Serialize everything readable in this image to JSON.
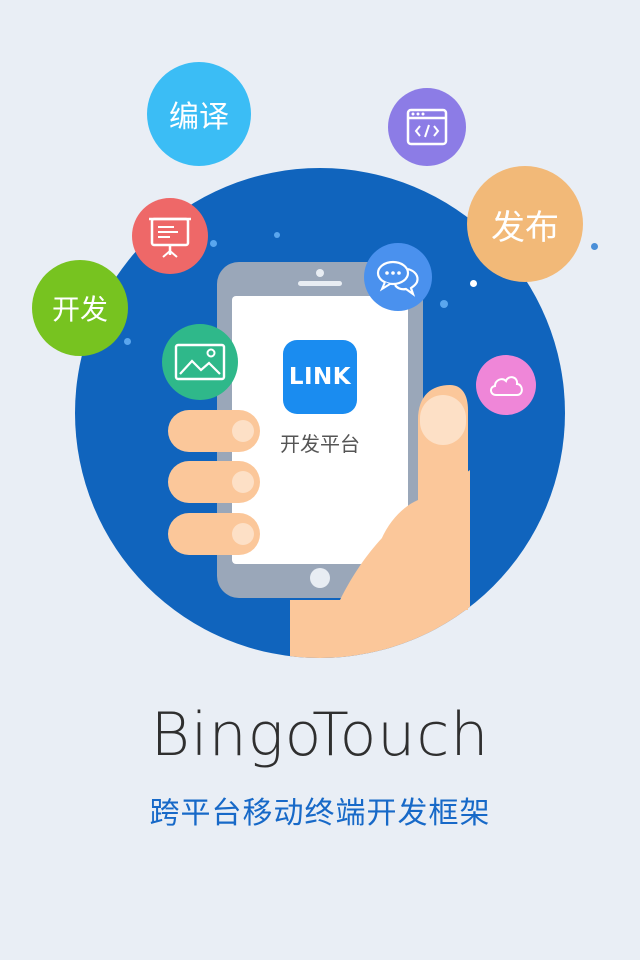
{
  "splash": {
    "app_name": "BingoTouch",
    "tagline": "跨平台移动终端开发框架",
    "phone": {
      "logo_text": "LINK",
      "logo_caption": "开发平台"
    },
    "bubbles": {
      "compile": "编译",
      "publish": "发布",
      "develop": "开发"
    },
    "icons": [
      "code-window-icon",
      "presentation-board-icon",
      "chat-bubbles-icon",
      "picture-icon",
      "cloud-icon",
      "hand-holding-phone-illustration"
    ]
  },
  "colors": {
    "background": "#e9eef5",
    "circle": "#1064bd",
    "compile": "#3bbdf5",
    "publish": "#f2b978",
    "develop": "#77c320",
    "code": "#8c7ce6",
    "board": "#ee6868",
    "chat": "#4a91ee",
    "picture": "#2fb88a",
    "cloud": "#ef86d8",
    "logo": "#1a8cf0",
    "tagline": "#1769c8"
  }
}
